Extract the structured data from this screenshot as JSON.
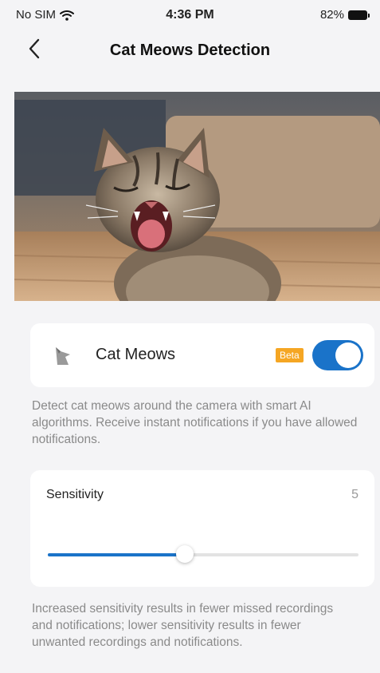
{
  "status_bar": {
    "carrier": "No SIM",
    "time": "4:36 PM",
    "battery": "82%",
    "wifi_icon": "wifi-icon",
    "battery_icon": "battery-icon"
  },
  "nav": {
    "title": "Cat Meows Detection",
    "back_icon": "chevron-left-icon"
  },
  "hero": {
    "image_description_icon": "cat-photo"
  },
  "cat_meows": {
    "label": "Cat Meows",
    "badge": "Beta",
    "enabled": true,
    "icon": "cat-meows-icon",
    "description": "Detect cat meows around the camera with smart AI algorithms. Receive instant notifications if you have allowed notifications."
  },
  "sensitivity": {
    "label": "Sensitivity",
    "value": "5",
    "level_fraction": 0.44,
    "note": "Increased sensitivity results in fewer missed recordings and notifications; lower sensitivity results in fewer unwanted recordings and notifications."
  },
  "colors": {
    "accent": "#1a73c9",
    "beta": "#f5a623",
    "background": "#f4f4f6",
    "card": "#ffffff",
    "muted_text": "#8a8a8a"
  }
}
